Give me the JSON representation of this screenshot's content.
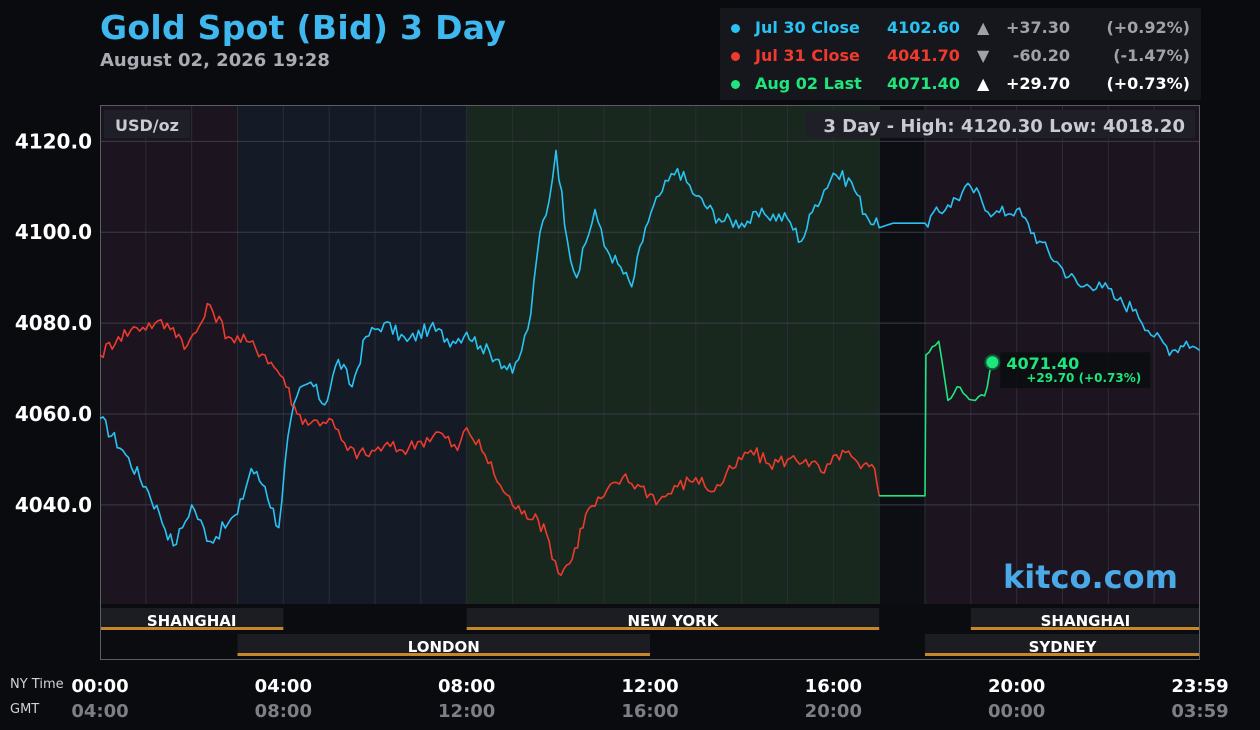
{
  "header": {
    "title": "Gold Spot (Bid) 3 Day",
    "datetime": "August 02, 2026 19:28"
  },
  "legend": [
    {
      "label": "Jul 30 Close",
      "value": "4102.60",
      "arrow": "▲",
      "change": "+37.30",
      "pct": "(+0.92%)",
      "color": "#29c3f3",
      "muted": true
    },
    {
      "label": "Jul 31 Close",
      "value": "4041.70",
      "arrow": "▼",
      "change": "-60.20",
      "pct": "(-1.47%)",
      "color": "#ef3a2d",
      "muted": true
    },
    {
      "label": "Aug 02 Last",
      "value": "4071.40",
      "arrow": "▲",
      "change": "+29.70",
      "pct": "(+0.73%)",
      "color": "#1ee67c",
      "muted": false
    }
  ],
  "plot": {
    "unit": "USD/oz",
    "range_label": "3 Day - High: 4120.30  Low: 4018.20",
    "last_label": "4071.40",
    "last_change": "+29.70 (+0.73%)",
    "brand": "kitco.com",
    "ny_time_label": "NY Time",
    "gmt_label": "GMT"
  },
  "sessions_row1": [
    {
      "name": "SHANGHAI",
      "start": 0,
      "end": 4
    },
    {
      "name": "NEW YORK",
      "start": 8,
      "end": 17
    },
    {
      "name": "SHANGHAI",
      "start": 19,
      "end": 24
    }
  ],
  "sessions_row2": [
    {
      "name": "LONDON",
      "start": 3,
      "end": 12
    },
    {
      "name": "SYDNEY",
      "start": 18,
      "end": 24
    }
  ],
  "colors": {
    "accent": "#3fb8f0",
    "day1": "#29c3f3",
    "day2": "#ef3a2d",
    "day3": "#1ee67c",
    "session_bar": "#c8862b",
    "ny_shade": "#18281f",
    "asia_shade": "#1c1520",
    "london_shade": "#141a26"
  },
  "chart_data": {
    "type": "line",
    "title": "Gold Spot (Bid) 3 Day",
    "ylabel": "USD/oz",
    "ylim": [
      4018.2,
      4128
    ],
    "xlim_hours": [
      0,
      24
    ],
    "yticks": [
      "4040.0",
      "4060.0",
      "4080.0",
      "4100.0",
      "4120.0"
    ],
    "xticks_ny": [
      "00:00",
      "04:00",
      "08:00",
      "12:00",
      "16:00",
      "20:00",
      "23:59"
    ],
    "xticks_gmt": [
      "04:00",
      "08:00",
      "12:00",
      "16:00",
      "20:00",
      "00:00",
      "03:59"
    ],
    "high": 4120.3,
    "low": 4018.2,
    "series": [
      {
        "name": "Jul 30 Close",
        "color": "#29c3f3",
        "x": [
          0,
          0.5,
          1,
          1.3,
          1.6,
          1.8,
          2.0,
          2.4,
          2.8,
          3.0,
          3.3,
          3.6,
          3.9,
          4.1,
          4.3,
          4.6,
          4.9,
          5.2,
          5.5,
          5.8,
          6.2,
          6.7,
          7.2,
          7.7,
          8.0,
          8.3,
          8.7,
          9.0,
          9.2,
          9.4,
          9.6,
          9.8,
          9.95,
          10.2,
          10.4,
          10.8,
          11.0,
          11.3,
          11.6,
          11.9,
          12.2,
          12.6,
          13.0,
          13.5,
          14.0,
          14.5,
          15.0,
          15.3,
          15.6,
          16.0,
          16.4,
          16.7,
          17.0,
          17.3,
          17.6,
          18.0,
          18.5,
          19.0,
          19.5,
          20.0,
          20.5,
          21.0,
          21.4,
          21.8,
          22.2,
          22.6,
          23.0,
          23.4,
          23.7,
          23.99
        ],
        "y": [
          4059,
          4052,
          4044,
          4038,
          4031,
          4035,
          4040,
          4032,
          4036,
          4038,
          4048,
          4044,
          4035,
          4055,
          4064,
          4067,
          4062,
          4072,
          4066,
          4077,
          4080,
          4076,
          4079,
          4076,
          4078,
          4075,
          4072,
          4069,
          4074,
          4082,
          4100,
          4107,
          4118,
          4098,
          4090,
          4105,
          4097,
          4093,
          4088,
          4101,
          4108,
          4114,
          4108,
          4103,
          4102,
          4104,
          4103,
          4098,
          4106,
          4113,
          4111,
          4104,
          4101,
          4102,
          4102,
          4102,
          4106,
          4110,
          4104,
          4105,
          4098,
          4092,
          4088,
          4089,
          4085,
          4083,
          4077,
          4074,
          4076,
          4074
        ]
      },
      {
        "name": "Jul 31 Close",
        "color": "#ef3a2d",
        "x": [
          0,
          0.4,
          0.8,
          1.2,
          1.6,
          1.9,
          2.1,
          2.4,
          2.8,
          3.2,
          3.6,
          4.0,
          4.3,
          4.6,
          5.0,
          5.4,
          5.8,
          6.2,
          6.6,
          7.0,
          7.4,
          7.8,
          8.0,
          8.4,
          8.8,
          9.2,
          9.5,
          9.8,
          10.0,
          10.3,
          10.6,
          11.0,
          11.4,
          11.8,
          12.2,
          12.6,
          13.0,
          13.4,
          13.8,
          14.2,
          14.6,
          15.0,
          15.4,
          15.8,
          16.2,
          16.6,
          16.9,
          17.0
        ],
        "y": [
          4073,
          4077,
          4079,
          4080,
          4079,
          4075,
          4078,
          4084,
          4077,
          4076,
          4073,
          4068,
          4060,
          4058,
          4059,
          4052,
          4051,
          4053,
          4052,
          4054,
          4056,
          4052,
          4057,
          4051,
          4043,
          4038,
          4038,
          4032,
          4025,
          4028,
          4038,
          4042,
          4046,
          4044,
          4041,
          4044,
          4046,
          4043,
          4048,
          4052,
          4049,
          4050,
          4050,
          4047,
          4052,
          4048,
          4048,
          4042
        ]
      },
      {
        "name": "Aug 02 Last",
        "color": "#1ee67c",
        "x": [
          17.0,
          18.0,
          18.02,
          18.3,
          18.5,
          18.7,
          18.9,
          19.1,
          19.3,
          19.47
        ],
        "y": [
          4042,
          4042,
          4073,
          4076,
          4063,
          4066,
          4064,
          4063,
          4064,
          4071.4
        ]
      }
    ]
  }
}
